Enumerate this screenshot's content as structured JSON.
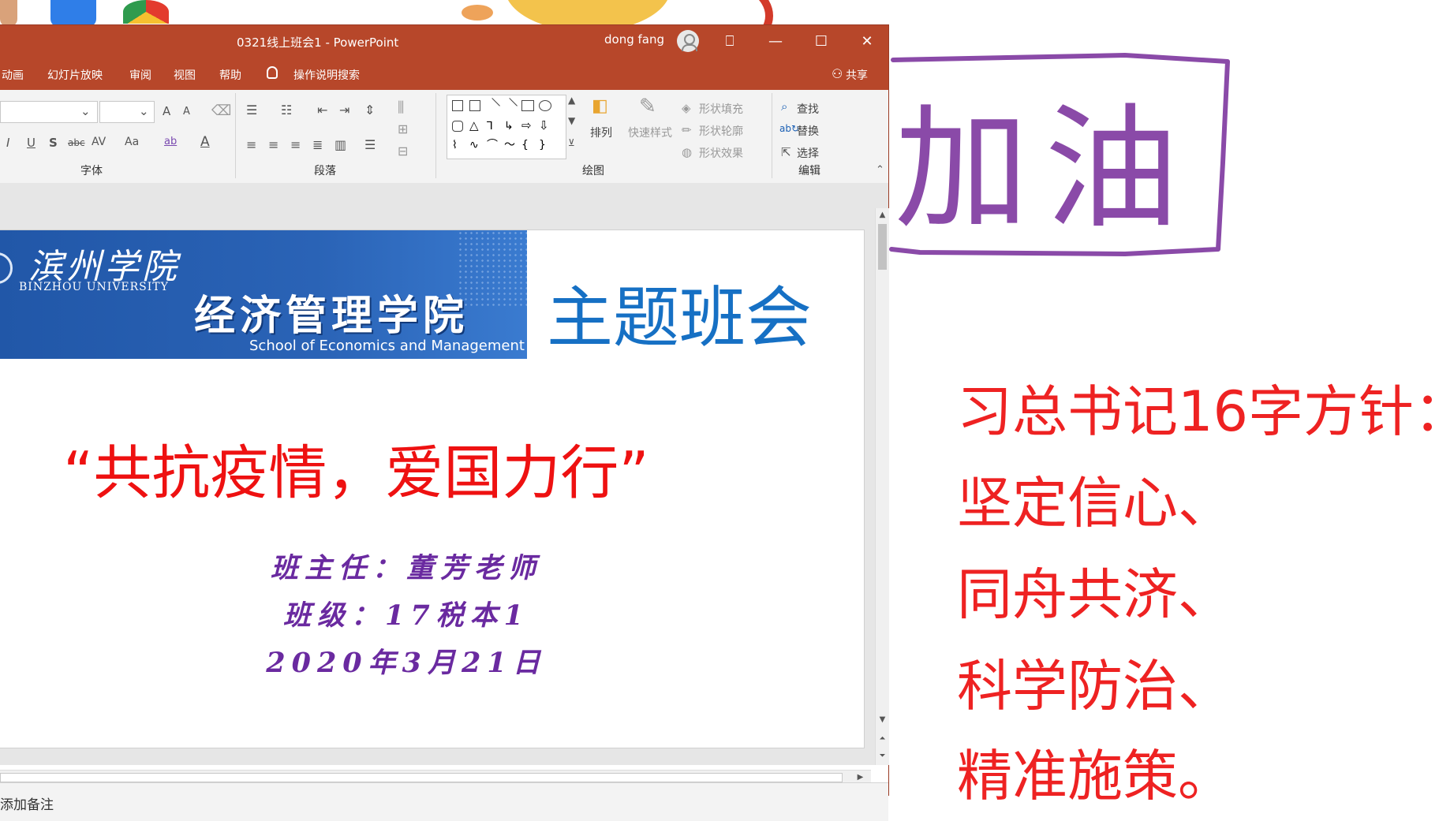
{
  "window": {
    "title": "0321线上班会1 - PowerPoint",
    "user": "dong fang",
    "controls": {
      "ribbon_options": "⎕",
      "minimize": "—",
      "maximize": "☐",
      "close": "✕"
    }
  },
  "menu": {
    "items": [
      "动画",
      "幻灯片放映",
      "审阅",
      "视图",
      "帮助"
    ],
    "tell_me": "操作说明搜索",
    "share": "共享"
  },
  "ribbon": {
    "groups": {
      "font": "字体",
      "paragraph": "段落",
      "drawing": "绘图",
      "editing": "编辑"
    },
    "font_buttons": {
      "italic": "I",
      "underline": "U",
      "shadow": "S",
      "strike": "abc",
      "spacing": "AV",
      "case": "Aa",
      "grow": "A",
      "shrink": "A",
      "highlight": "ab",
      "color": "A"
    },
    "drawing": {
      "arrange": "排列",
      "quick_styles": "快速样式",
      "shape_fill": "形状填充",
      "shape_outline": "形状轮廓",
      "shape_effects": "形状效果"
    },
    "editing": {
      "find": "查找",
      "replace": "替换",
      "select": "选择"
    }
  },
  "slide": {
    "university_script": "滨州学院",
    "university_en": "BINZHOU UNIVERSITY",
    "school_cn": "经济管理学院",
    "school_en": "School of Economics and Management",
    "title": "主题班会",
    "subtitle": "“共抗疫情，爱国力行”",
    "teacher": "班主任：董芳老师",
    "class": "班级：17税本1",
    "date": "2020年3月21日"
  },
  "notes_placeholder": "添加备注",
  "annotations": {
    "handwriting": "加油",
    "guideline_title": "习总书记16字方针：",
    "guideline_items": [
      "坚定信心、",
      "同舟共济、",
      "科学防治、",
      "精准施策。"
    ]
  },
  "colors": {
    "ppt_accent": "#b7472a",
    "slide_title_blue": "#1670c4",
    "subtitle_red": "#ee1111",
    "info_purple": "#6a2aa0",
    "annotation_red": "#ee2222",
    "handwriting_purple": "#8a4aa8"
  }
}
